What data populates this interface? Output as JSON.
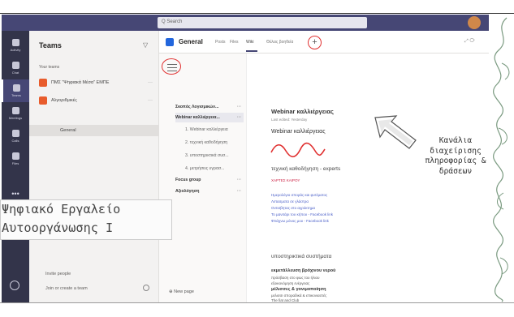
{
  "search": {
    "placeholder": "Q Search"
  },
  "rail": {
    "items": [
      {
        "label": "Activity",
        "icon": "bell-icon"
      },
      {
        "label": "Chat",
        "icon": "chat-icon"
      },
      {
        "label": "Teams",
        "icon": "teams-icon",
        "active": true
      },
      {
        "label": "Meetings",
        "icon": "calendar-icon"
      },
      {
        "label": "Calls",
        "icon": "phone-icon"
      },
      {
        "label": "Files",
        "icon": "file-icon"
      }
    ],
    "more": "•••",
    "help_label": "Help"
  },
  "teams_panel": {
    "title": "Teams",
    "your_teams_label": "Your teams",
    "teams": [
      {
        "name": "ΠΜΣ \"Ψηφιακά Μέσα\" ΕΜΠΕ",
        "color": "#e85c2c"
      },
      {
        "name": "Αλγοριθμικές",
        "color": "#e85c2c"
      }
    ],
    "channel": "General",
    "invite_label": "Invite people",
    "join_label": "Join or create a team"
  },
  "channel_header": {
    "name": "General",
    "tabs": [
      "Posts",
      "Files",
      "Wiki",
      "Θέλεις βοηθεία"
    ],
    "active_tab": "Wiki"
  },
  "onenote": {
    "sections": [
      {
        "label": "Σκοπός Λογισμικών...",
        "type": "section"
      },
      {
        "label": "Webinar καλλιέργεια...",
        "type": "section",
        "selected": true
      },
      {
        "label": "1. Webinar καλλιέργεια",
        "type": "page"
      },
      {
        "label": "2. τεχνική καθοδήγηση",
        "type": "page"
      },
      {
        "label": "3. υποστηρικτικά συσ...",
        "type": "page"
      },
      {
        "label": "4. μετρήσεις υγρασ...",
        "type": "page"
      },
      {
        "label": "Focus group",
        "type": "section"
      },
      {
        "label": "Αξιολόγηση",
        "type": "section"
      }
    ],
    "new_page_label": "New page"
  },
  "page": {
    "title": "Webinar καλλιέργειας",
    "date": "Last edited: Yesterday",
    "title2": "Webinar καλλιέργειας",
    "experts_heading": "τεχνική καθοδήγηση - experts",
    "red_text": "ΧΑΡΤΕΣ ΚΑΙΡΟΥ",
    "links": [
      "Ημερολόγιο σποράς και φυτέματος",
      "Λιπασματα σε γλάστρα",
      "Οντισβητας στο αγρόκτημα",
      "Το μανιτάρι του κήπου - Facebook link",
      "Φτιάχνω μόνος μου - Facebook link"
    ],
    "support_heading": "υποστηρικτικά συστήματα",
    "bold1": "εκμετάλλευση βρόχινου νερού",
    "small1": "πρόσβαση στο φως του ήλιου",
    "small2": "εξοικονόμηση ενέργειας",
    "bold2": "μέλισσες & γονιμοποίηση",
    "small3": "μελισσι σποραδικά & επικονιαστές",
    "small4": "The fiat and Club"
  },
  "annotation": {
    "lines": [
      "Κανάλια",
      "διαχείρισης",
      "πληροφορίας &",
      "δράσεων"
    ]
  },
  "overlay": {
    "line1": "Ψηφιακό Εργαλείο",
    "line2": "Αυτοοργάνωσης Ι"
  },
  "colors": {
    "titlebar": "#464775",
    "rail": "#33344a",
    "accent_red": "#e03030",
    "channel_blue": "#2266dd"
  }
}
